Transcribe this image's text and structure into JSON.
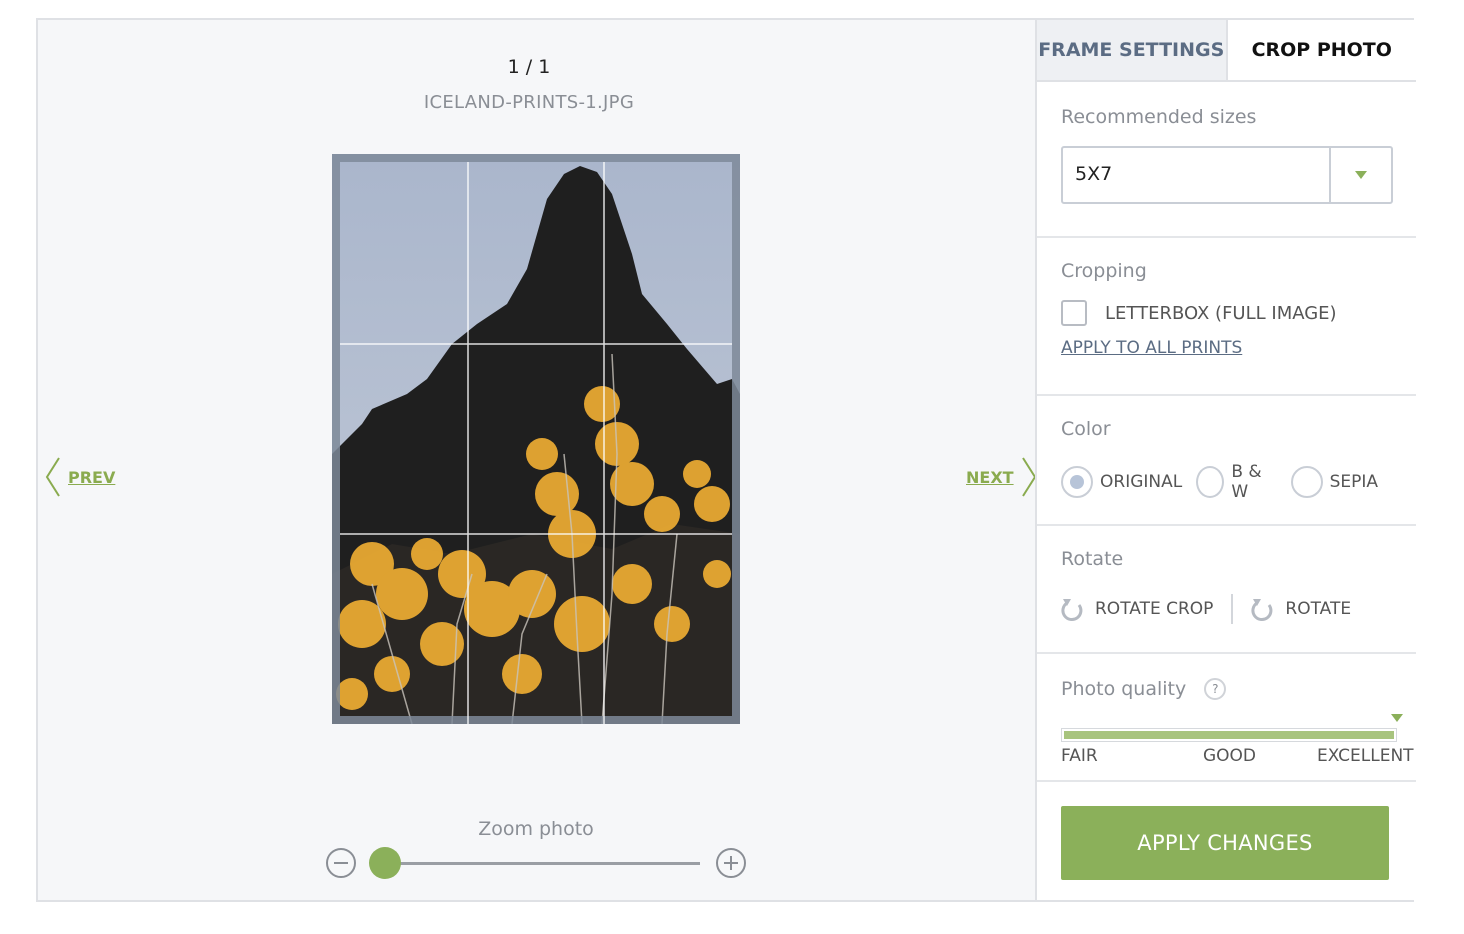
{
  "viewer": {
    "counter": "1 / 1",
    "filename": "ICELAND-PRINTS-1.JPG",
    "prev_label": "PREV",
    "next_label": "NEXT",
    "zoom_label": "Zoom photo",
    "zoom_level": 0.0
  },
  "tabs": [
    {
      "label": "FRAME SETTINGS",
      "active": false
    },
    {
      "label": "CROP PHOTO",
      "active": true
    }
  ],
  "panel": {
    "recommended": {
      "title": "Recommended sizes",
      "selected": "5X7"
    },
    "cropping": {
      "title": "Cropping",
      "letterbox_label": "LETTERBOX (FULL IMAGE)",
      "letterbox_checked": false,
      "apply_all_label": "APPLY TO ALL PRINTS"
    },
    "color": {
      "title": "Color",
      "options": [
        "ORIGINAL",
        "B & W",
        "SEPIA"
      ],
      "selected": "ORIGINAL"
    },
    "rotate": {
      "title": "Rotate",
      "rotate_crop_label": "ROTATE CROP",
      "rotate_label": "ROTATE"
    },
    "quality": {
      "title": "Photo quality",
      "help": "?",
      "level": 1.0,
      "labels": [
        "FAIR",
        "GOOD",
        "EXCELLENT"
      ]
    },
    "apply_button": "APPLY CHANGES"
  },
  "colors": {
    "accent": "#8bb05a",
    "tab_inactive_text": "#5b6c83"
  },
  "icons": [
    "chevron-left-icon",
    "chevron-right-icon",
    "zoom-out-icon",
    "zoom-in-icon",
    "dropdown-caret-icon",
    "rotate-icon",
    "help-icon"
  ]
}
